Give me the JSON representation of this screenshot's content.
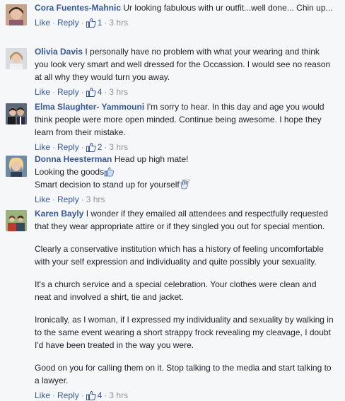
{
  "actions": {
    "like": "Like",
    "reply": "Reply",
    "separator": "·"
  },
  "comments": [
    {
      "author": "Cora Fuentes-Mahnic",
      "text": "Ur looking fabulous with ur outfit...well done... Chin up...",
      "likes": "1",
      "time": "3 hrs"
    },
    {
      "author": "Olivia Davis",
      "text": "I personally have no problem with what your wearing and think you look very smart and well dressed for the Occassion. I would see no reason at all why they would turn you away.",
      "likes": "4",
      "time": "3 hrs"
    },
    {
      "author": "Elma Slaughter- Yammouni",
      "text": "I'm sorry to hear. In this day and age you would think people were more open minded. Continue being awesome. I hope they learn from their mistake.",
      "likes": "2",
      "time": "3 hrs"
    },
    {
      "author": "Donna Heesterman",
      "line1": "Head up high mate!",
      "line2": "Looking the goods",
      "line3": "Smart decision to stand up for yourself",
      "time": "3 hrs"
    },
    {
      "author": "Karen Bayly",
      "paragraphs": [
        "I wonder if they emailed all attendees and respectfully requested that they wear appropriate attire or if they singled you out for special mention.",
        "Clearly a conservative institution which has a history of feeling uncomfortable with your self expression and individuality and quite possibly your sexuality.",
        "It's a church service and a special celebration. Your clothes were clean and neat and involved a shirt, tie and jacket.",
        "Ironically, as I woman, if I expressed my individuality and sexuality by walking in to the same event wearing a short strappy frock revealing my cleavage, I doubt I'd have been treated in the way you were.",
        "Good on you for calling them on it. Stop talking to the media and start talking to a lawyer."
      ],
      "likes": "4",
      "time": "3 hrs"
    }
  ],
  "colors": {
    "background": "#f6f7f9",
    "author": "#365899",
    "text": "#1d2129",
    "meta": "#90949c"
  }
}
